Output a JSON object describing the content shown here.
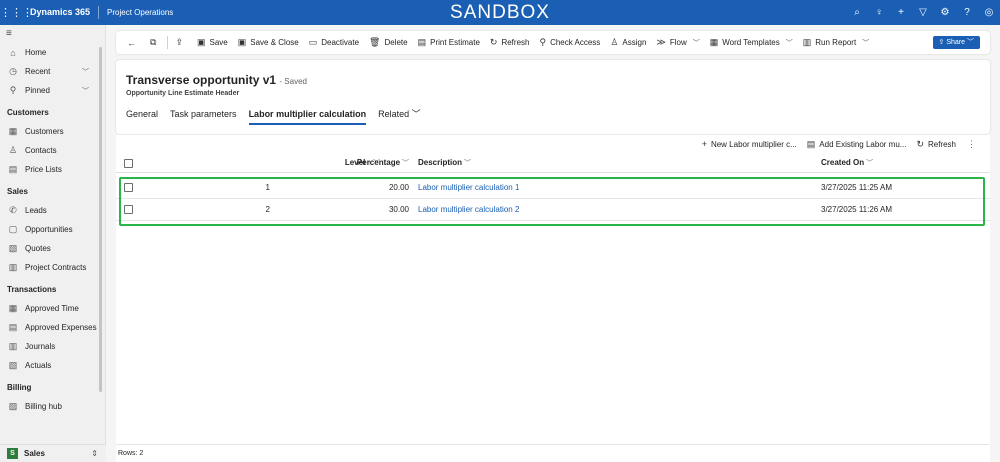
{
  "topbar": {
    "brand": "Dynamics 365",
    "app_name": "Project Operations",
    "environment": "SANDBOX",
    "icons": [
      "search-icon",
      "lightbulb-icon",
      "plus-icon",
      "filter-icon",
      "settings-icon",
      "help-icon",
      "copilot-icon"
    ]
  },
  "sidebar": {
    "home": "Home",
    "recent": "Recent",
    "pinned": "Pinned",
    "section_customers": "Customers",
    "customers": "Customers",
    "contacts": "Contacts",
    "price_lists": "Price Lists",
    "section_sales": "Sales",
    "leads": "Leads",
    "opportunities": "Opportunities",
    "quotes": "Quotes",
    "project_contracts": "Project Contracts",
    "section_transactions": "Transactions",
    "approved_time": "Approved Time",
    "approved_expenses": "Approved Expenses",
    "journals": "Journals",
    "actuals": "Actuals",
    "section_billing": "Billing",
    "billing_hub": "Billing hub",
    "area_badge": "S",
    "area_label": "Sales"
  },
  "commandbar": {
    "save": "Save",
    "save_close": "Save & Close",
    "deactivate": "Deactivate",
    "delete": "Delete",
    "print_estimate": "Print Estimate",
    "refresh": "Refresh",
    "check_access": "Check Access",
    "assign": "Assign",
    "flow": "Flow",
    "word_templates": "Word Templates",
    "run_report": "Run Report",
    "share": "Share"
  },
  "record": {
    "title": "Transverse opportunity v1",
    "status": "- Saved",
    "entity": "Opportunity Line Estimate Header",
    "tabs": [
      "General",
      "Task parameters",
      "Labor multiplier calculation",
      "Related"
    ],
    "active_tab": "Labor multiplier calculation"
  },
  "subgrid": {
    "new_label": "New Labor multiplier c...",
    "add_existing_label": "Add Existing Labor mu...",
    "refresh_label": "Refresh",
    "columns": {
      "level": "Level",
      "level_sort": "↑",
      "percentage": "Percentage",
      "description": "Description",
      "created_on": "Created On"
    },
    "rows": [
      {
        "level": "1",
        "percentage": "20.00",
        "description": "Labor multiplier calculation 1",
        "created_on": "3/27/2025 11:25 AM"
      },
      {
        "level": "2",
        "percentage": "30.00",
        "description": "Labor multiplier calculation 2",
        "created_on": "3/27/2025 11:26 AM"
      }
    ],
    "footer": "Rows: 2"
  },
  "colors": {
    "topbar": "#1a5fb4",
    "highlight": "#2ab54a",
    "link": "#1a5fb4"
  }
}
